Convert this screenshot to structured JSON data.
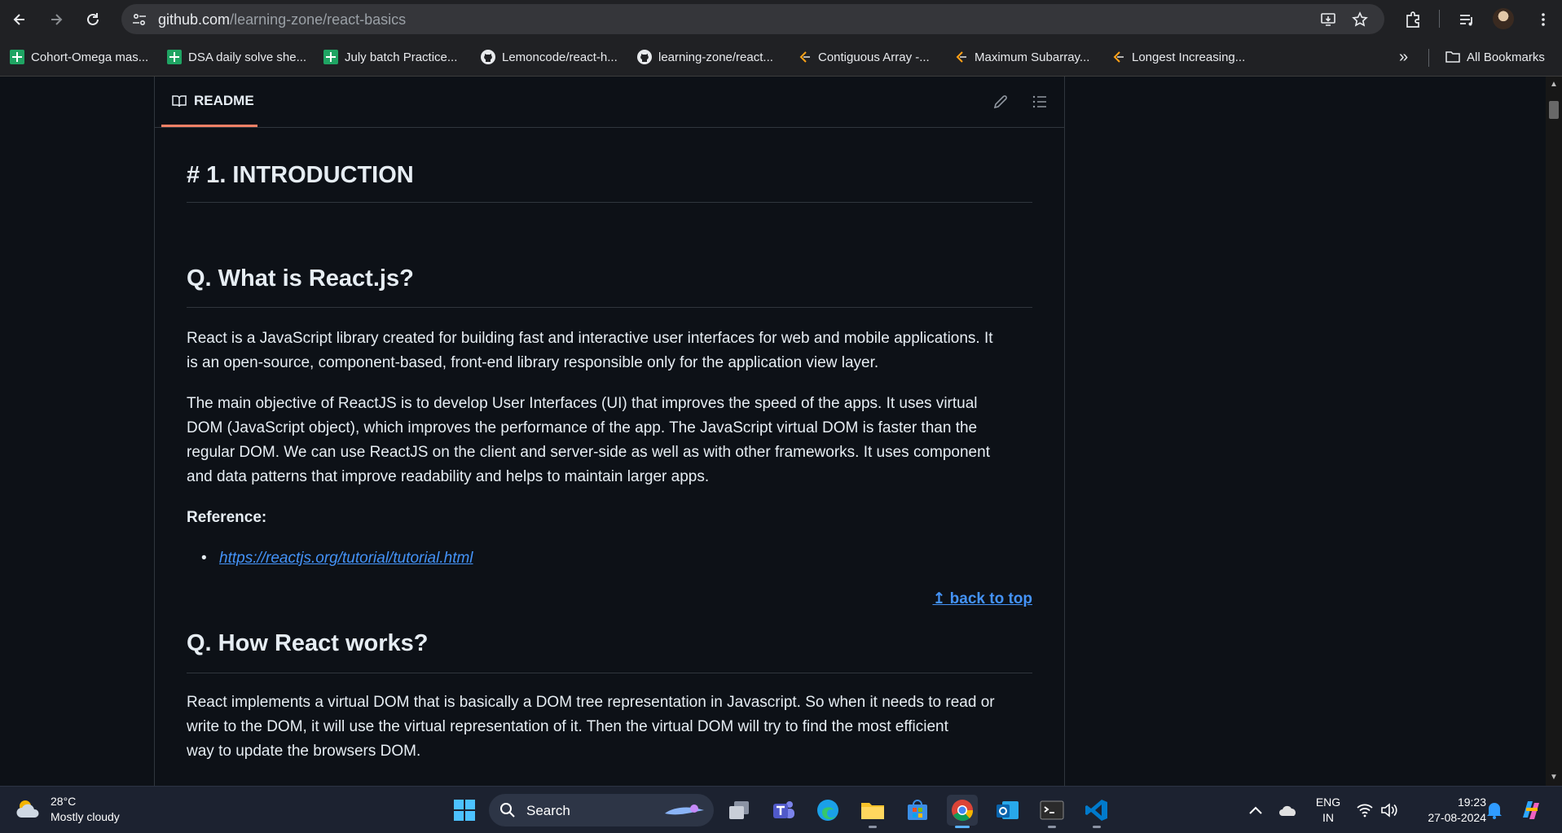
{
  "browser": {
    "url_host": "github.com",
    "url_path": "/learning-zone/react-basics"
  },
  "bookmarks": {
    "items": [
      {
        "label": "Cohort-Omega mas...",
        "icon": "sheets-icon"
      },
      {
        "label": "DSA daily solve she...",
        "icon": "sheets-icon"
      },
      {
        "label": "July batch Practice...",
        "icon": "sheets-icon"
      },
      {
        "label": "Lemoncode/react-h...",
        "icon": "github-icon"
      },
      {
        "label": "learning-zone/react...",
        "icon": "github-icon"
      },
      {
        "label": "Contiguous Array -...",
        "icon": "leetcode-icon"
      },
      {
        "label": "Maximum Subarray...",
        "icon": "leetcode-icon"
      },
      {
        "label": "Longest Increasing...",
        "icon": "leetcode-icon"
      }
    ],
    "more_label": "»",
    "all_bookmarks": "All Bookmarks"
  },
  "readme": {
    "tab_label": "README"
  },
  "article": {
    "h1": "# 1. INTRODUCTION",
    "s1_title": "Q. What is React.js?",
    "s1_p1_l1": "React is a JavaScript library created for building fast and interactive user interfaces for web and mobile applications. It",
    "s1_p1_l2": "is an open-source, component-based, front-end library responsible only for the application view layer.",
    "s1_p2_l1": "The main objective of ReactJS is to develop User Interfaces (UI) that improves the speed of the apps. It uses virtual",
    "s1_p2_l2": "DOM (JavaScript object), which improves the performance of the app. The JavaScript virtual DOM is faster than the",
    "s1_p2_l3": "regular DOM. We can use ReactJS on the client and server-side as well as with other frameworks. It uses component",
    "s1_p2_l4": "and data patterns that improve readability and helps to maintain larger apps.",
    "reference_label": "Reference:",
    "reference_link": "https://reactjs.org/tutorial/tutorial.html",
    "back_to_top": "↥ back to top",
    "s2_title": "Q. How React works?",
    "s2_p1_l1": "React implements a virtual DOM that is basically a DOM tree representation in Javascript. So when it needs to read or",
    "s2_p1_l2": "write to the DOM, it will use the virtual representation of it. Then the virtual DOM will try to find the most efficient",
    "s2_p1_l3": "way to update the browsers DOM."
  },
  "taskbar": {
    "temperature": "28°C",
    "weather": "Mostly cloudy",
    "search_label": "Search",
    "lang_top": "ENG",
    "lang_bottom": "IN",
    "time": "19:23",
    "date": "27-08-2024"
  },
  "colors": {
    "accent": "#4493f8",
    "tab_underline": "#f78166",
    "background": "#0d1117"
  }
}
